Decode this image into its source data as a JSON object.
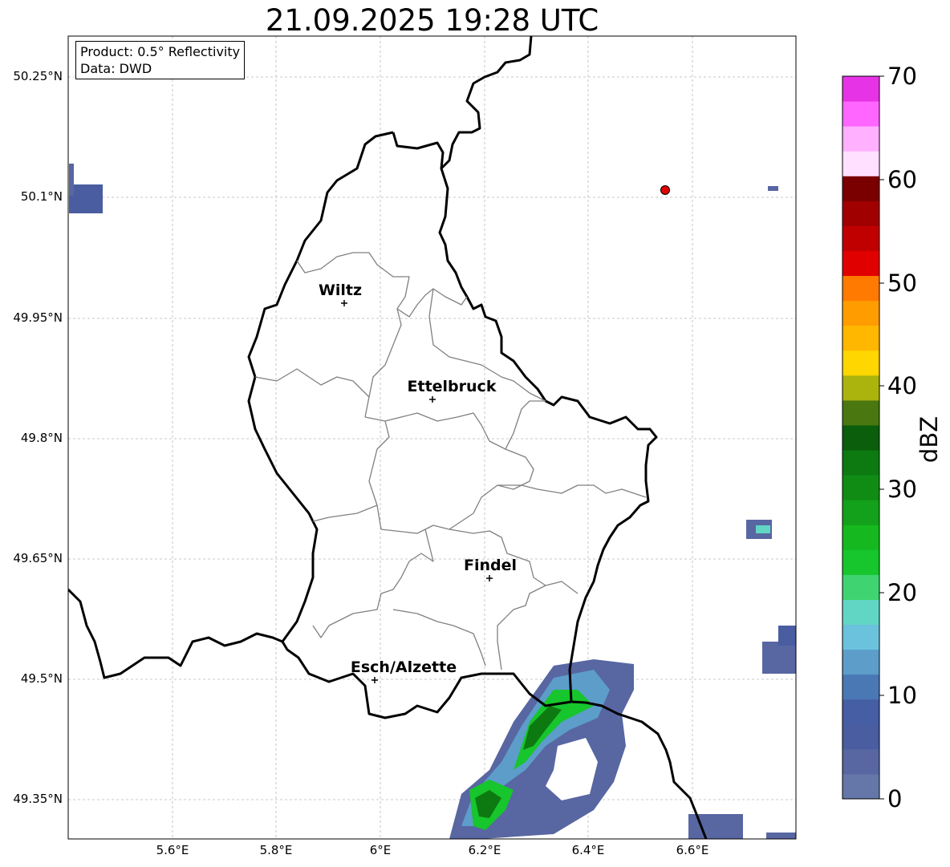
{
  "title": "21.09.2025 19:28 UTC",
  "info": {
    "product": "Product: 0.5° Reflectivity",
    "data_source": "Data: DWD"
  },
  "lat_labels": [
    "50.25°N",
    "50.1°N",
    "49.95°N",
    "49.8°N",
    "49.65°N",
    "49.5°N",
    "49.35°N"
  ],
  "lon_labels": [
    "5.6°E",
    "5.8°E",
    "6°E",
    "6.2°E",
    "6.4°E",
    "6.6°E"
  ],
  "cities": [
    {
      "name": "Wiltz",
      "lon": 5.93,
      "lat": 49.97
    },
    {
      "name": "Ettelbruck",
      "lon": 6.1,
      "lat": 49.85
    },
    {
      "name": "Findel",
      "lon": 6.21,
      "lat": 49.627
    },
    {
      "name": "Esch/Alzette",
      "lon": 5.99,
      "lat": 49.5
    }
  ],
  "radar_site": {
    "lon": 6.55,
    "lat": 50.11,
    "color": "#e00000"
  },
  "colorbar": {
    "label": "dBZ",
    "ticks": [
      "0",
      "10",
      "20",
      "30",
      "40",
      "50",
      "60",
      "70"
    ],
    "colors": [
      "#6577a8",
      "#5866a2",
      "#4a5da0",
      "#455ea4",
      "#4a78b4",
      "#5c9dca",
      "#6bc2dd",
      "#62d6c4",
      "#3fd471",
      "#17c52c",
      "#15b91f",
      "#13a01b",
      "#108c15",
      "#0c7a10",
      "#0a5e0c",
      "#4a7710",
      "#aab40c",
      "#ffd600",
      "#ffb700",
      "#ff9c00",
      "#ff7a00",
      "#e00000",
      "#c00000",
      "#a00000",
      "#7a0000",
      "#ffe0ff",
      "#ffb0ff",
      "#ff66ff",
      "#e633e6"
    ]
  }
}
